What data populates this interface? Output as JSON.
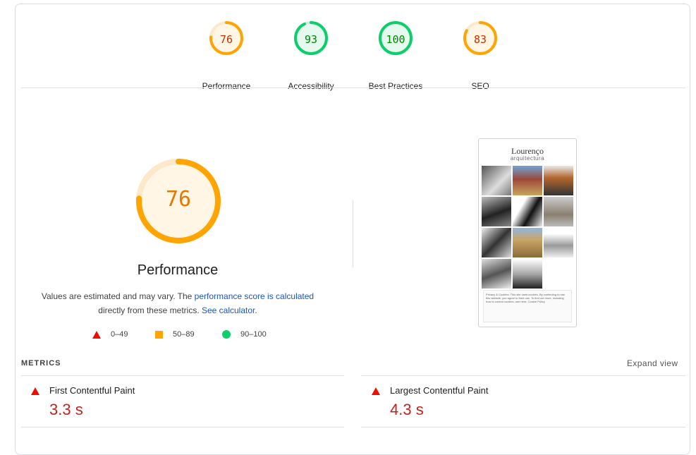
{
  "categories": [
    {
      "label": "Performance",
      "score": "76",
      "value": 76,
      "color": "#ffa400",
      "bg": "#fff6e6",
      "text_color": "#c33300"
    },
    {
      "label": "Accessibility",
      "score": "93",
      "value": 93,
      "color": "#0cce6b",
      "bg": "#e6f9ef",
      "text_color": "#008800"
    },
    {
      "label": "Best Practices",
      "score": "100",
      "value": 100,
      "color": "#0cce6b",
      "bg": "#e6f9ef",
      "text_color": "#008800"
    },
    {
      "label": "SEO",
      "score": "83",
      "value": 83,
      "color": "#ffa400",
      "bg": "#fff6e6",
      "text_color": "#c33300"
    }
  ],
  "main": {
    "score": "76",
    "value": 76,
    "title": "Performance",
    "desc_pre": "Values are estimated and may vary. The ",
    "desc_link1": "performance score is calculated",
    "desc_mid": " directly from these metrics. ",
    "desc_link2": "See calculator",
    "desc_post": "."
  },
  "legend": [
    {
      "shape": "triangle",
      "range": "0–49",
      "color": "#eb0f00"
    },
    {
      "shape": "square",
      "range": "50–89",
      "color": "#ffa400"
    },
    {
      "shape": "circle",
      "range": "90–100",
      "color": "#0cce6b"
    }
  ],
  "screenshot": {
    "brand_line1": "Lourenço",
    "brand_line2": "arquitectura",
    "cookie_text": "Privacy & Cookies: This site uses cookies. By continuing to use this website, you agree to their use. To find out more, including how to control cookies, see here: Cookie Policy"
  },
  "metrics": {
    "heading": "METRICS",
    "expand_label": "Expand view",
    "items": [
      {
        "title": "First Contentful Paint",
        "value": "3.3 s",
        "status": "fail"
      },
      {
        "title": "Largest Contentful Paint",
        "value": "4.3 s",
        "status": "fail"
      }
    ]
  },
  "colors": {
    "fail": "#eb0f00",
    "average": "#ffa400",
    "pass": "#0cce6b",
    "link": "#1a56c4",
    "value_fail": "#c5221f"
  }
}
